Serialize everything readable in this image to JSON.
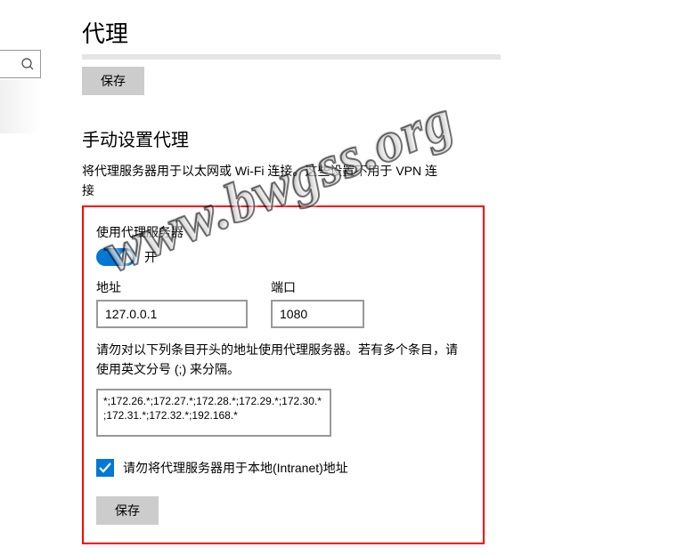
{
  "page_title": "代理",
  "top_save_button": "保存",
  "section_title": "手动设置代理",
  "description_line1": "将代理服务器用于以太网或 Wi-Fi 连接。这些设置不用于 VPN 连",
  "description_line2": "接",
  "use_proxy_label": "使用代理服务器",
  "toggle_state_label": "开",
  "toggle_on": true,
  "address_caption": "地址",
  "address_value": "127.0.0.1",
  "port_caption": "端口",
  "port_value": "1080",
  "exceptions_note": "请勿对以下列条目开头的地址使用代理服务器。若有多个条目，请使用英文分号 (;) 来分隔。",
  "exceptions_value": "*;172.26.*;172.27.*;172.28.*;172.29.*;172.30.*;172.31.*;172.32.*;192.168.*",
  "intranet_checkbox_label": "请勿将代理服务器用于本地(Intranet)地址",
  "intranet_checked": true,
  "bottom_save_button": "保存",
  "watermark_text": "www.bwgss.org",
  "colors": {
    "accent": "#0078d7",
    "highlight_box": "#ff0000",
    "button_bg": "#cccccc"
  }
}
